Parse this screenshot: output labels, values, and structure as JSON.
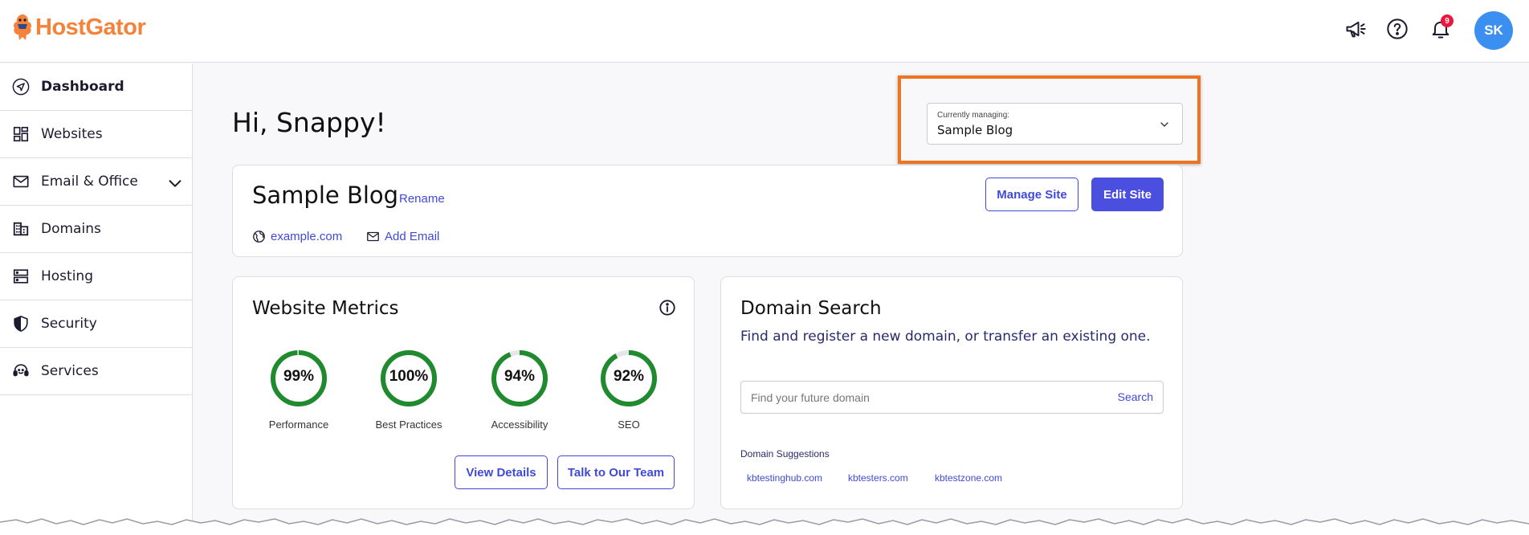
{
  "header": {
    "brand": "HostGator",
    "notification_count": "9",
    "avatar_initials": "SK",
    "brand_color": "#f4823a"
  },
  "sidebar": {
    "items": [
      {
        "label": "Dashboard",
        "icon": "navigation-arrow-icon",
        "active": true
      },
      {
        "label": "Websites",
        "icon": "dashboard-grid-icon"
      },
      {
        "label": "Email & Office",
        "icon": "envelope-icon",
        "expandable": true
      },
      {
        "label": "Domains",
        "icon": "building-icon"
      },
      {
        "label": "Hosting",
        "icon": "server-icon"
      },
      {
        "label": "Security",
        "icon": "shield-icon"
      },
      {
        "label": "Services",
        "icon": "support-headset-icon"
      }
    ]
  },
  "main": {
    "greeting": "Hi, Snappy!",
    "managing": {
      "label": "Currently managing:",
      "value": "Sample Blog"
    },
    "site": {
      "title": "Sample Blog",
      "rename": "Rename",
      "domain": "example.com",
      "add_email": "Add Email",
      "manage_btn": "Manage Site",
      "edit_btn": "Edit Site"
    },
    "metrics": {
      "title": "Website Metrics",
      "items": [
        {
          "value": "99%",
          "label": "Performance",
          "score": 99
        },
        {
          "value": "100%",
          "label": "Best Practices",
          "score": 100
        },
        {
          "value": "94%",
          "label": "Accessibility",
          "score": 94
        },
        {
          "value": "92%",
          "label": "SEO",
          "score": 92
        }
      ],
      "view_details": "View Details",
      "talk_team": "Talk to Our Team"
    },
    "domain_search": {
      "title": "Domain Search",
      "description": "Find and register a new domain, or transfer an existing one.",
      "placeholder": "Find your future domain",
      "search_btn": "Search",
      "suggestions_label": "Domain Suggestions",
      "suggestions": [
        "kbtestinghub.com",
        "kbtesters.com",
        "kbtestzone.com"
      ]
    }
  },
  "colors": {
    "accent": "#4a4fe0",
    "link": "#3f4ad8",
    "highlight": "#ee7422",
    "gauge": "#1f8a2e",
    "badge": "#e8193c"
  }
}
